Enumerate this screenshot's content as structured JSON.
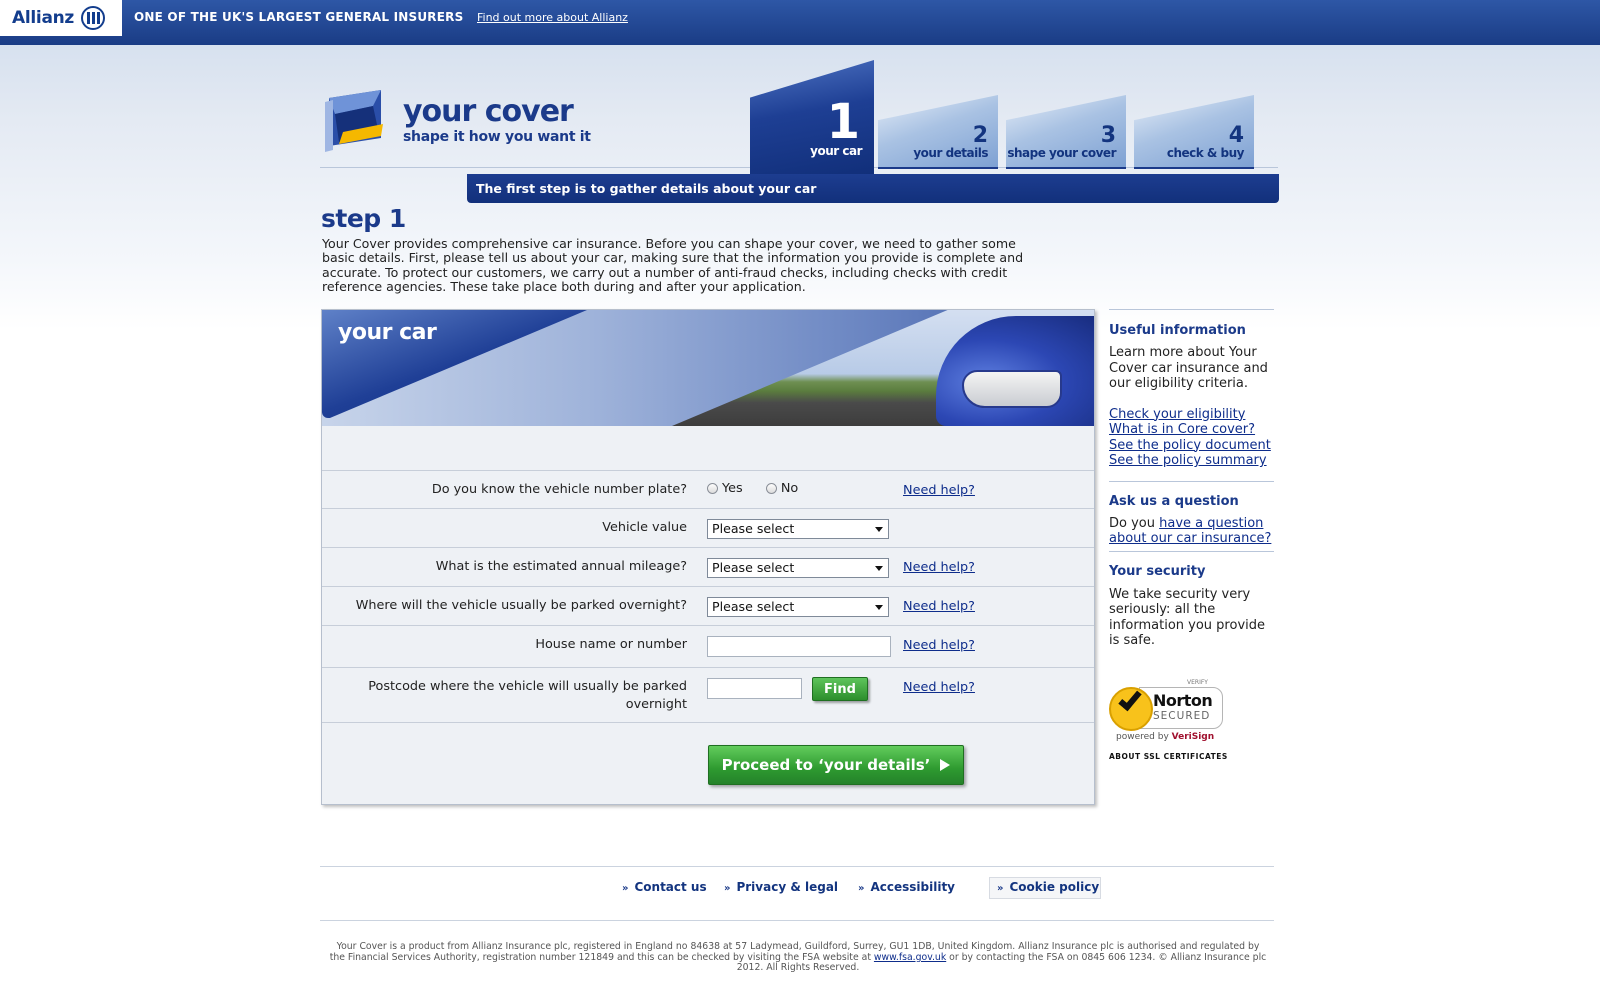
{
  "topbar": {
    "brand": "Allianz",
    "tagline": "ONE OF THE UK'S LARGEST GENERAL INSURERS",
    "link": "Find out more about Allianz"
  },
  "header": {
    "title": "your cover",
    "subtitle": "shape it how you want it"
  },
  "steps": [
    {
      "num": "1",
      "label": "your car",
      "active": true
    },
    {
      "num": "2",
      "label": "your details",
      "active": false
    },
    {
      "num": "3",
      "label": "shape your cover",
      "active": false
    },
    {
      "num": "4",
      "label": "check & buy",
      "active": false
    }
  ],
  "banner": "The first step is to gather details about your car",
  "step_title": "step 1",
  "intro": "Your Cover provides comprehensive car insurance. Before you can shape your cover, we need to gather some basic details. First, please tell us about your car, making sure that the information you provide is complete and accurate. To protect our customers, we carry out a number of anti-fraud checks, including checks with credit reference agencies. These take place both during and after your application.",
  "panel": {
    "title": "your car",
    "questions": {
      "plate": "Do you know the vehicle number plate?",
      "value": "Vehicle value",
      "mileage": "What is the estimated annual mileage?",
      "parking": "Where will the vehicle usually be parked overnight?",
      "house": "House name or number",
      "postcode": "Postcode where the vehicle will usually be parked overnight"
    },
    "radio_yes": "Yes",
    "radio_no": "No",
    "select_placeholder": "Please select",
    "need_help": "Need help?",
    "find": "Find",
    "proceed": "Proceed to ‘your details’"
  },
  "sidebar": {
    "useful_title": "Useful information",
    "useful_text": "Learn more about Your Cover car insurance and our eligibility criteria.",
    "links": [
      "Check your eligibility",
      "What is in Core cover?",
      "See the policy document",
      "See the policy summary"
    ],
    "ask_title": "Ask us a question",
    "ask_prefix": "Do you ",
    "ask_link": "have a question about our car insurance?",
    "security_title": "Your security",
    "security_text": "We take security very seriously: all the information you provide is safe.",
    "norton_verify": "VERIFY",
    "norton_name": "Norton",
    "norton_secured": "SECURED",
    "norton_powered": "powered by ",
    "norton_verisign": "VeriSign",
    "ssl": "ABOUT SSL CERTIFICATES"
  },
  "footer": {
    "links": [
      "Contact us",
      "Privacy & legal",
      "Accessibility",
      "Cookie policy"
    ],
    "legal_a": "Your Cover is a product from Allianz Insurance plc, registered in England no 84638 at 57 Ladymead, Guildford, Surrey, GU1 1DB, United Kingdom. Allianz Insurance plc is authorised and regulated by the Financial Services Authority, registration number 121849 and this can be checked by visiting the FSA website at ",
    "legal_link": "www.fsa.gov.uk",
    "legal_b": " or by contacting the FSA on 0845 606 1234. © Allianz Insurance plc 2012. All Rights Reserved."
  },
  "colors": {
    "brand_blue": "#1b3a8a",
    "topbar_blue": "#2e57a6",
    "cta_green": "#2e9a30"
  }
}
